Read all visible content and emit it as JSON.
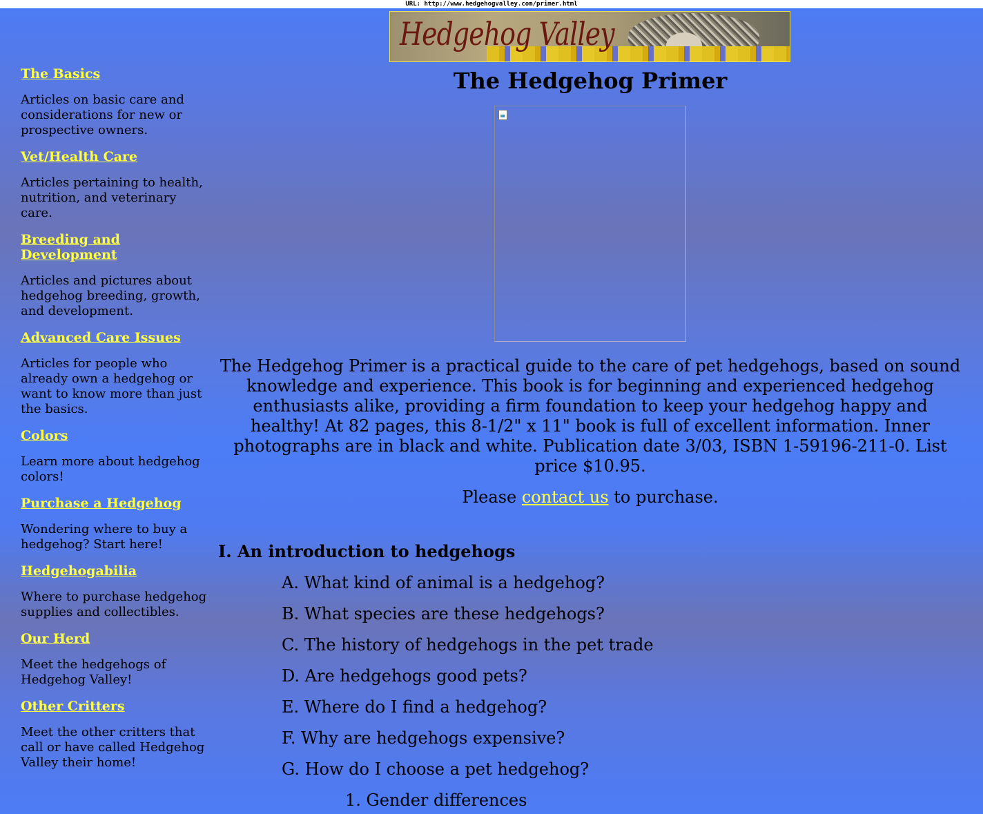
{
  "url_bar": "URL: http://www.hedgehogvalley.com/primer.html",
  "banner": {
    "logo_text": "Hedgehog Valley"
  },
  "sidebar": {
    "items": [
      {
        "label": "The Basics",
        "description": "Articles on basic care and considerations for new or prospective owners."
      },
      {
        "label": "Vet/Health Care",
        "description": "Articles pertaining to health, nutrition, and veterinary care."
      },
      {
        "label": "Breeding and Development",
        "description": "Articles and pictures about hedgehog breeding, growth, and development."
      },
      {
        "label": "Advanced Care Issues",
        "description": "Articles for people who already own a hedgehog or want to know more than just the basics."
      },
      {
        "label": "Colors",
        "description": "Learn more about hedgehog colors!"
      },
      {
        "label": "Purchase a Hedgehog",
        "description": "Wondering where to buy a hedgehog? Start here!"
      },
      {
        "label": "Hedgehogabilia",
        "description": "Where to purchase hedgehog supplies and collectibles."
      },
      {
        "label": "Our Herd",
        "description": "Meet the hedgehogs of Hedgehog Valley!"
      },
      {
        "label": "Other Critters",
        "description": "Meet the other critters that call or have called Hedgehog Valley their home!"
      }
    ]
  },
  "main": {
    "title": "The Hedgehog Primer",
    "description": "The Hedgehog Primer is a practical guide to the care of pet hedgehogs, based on sound knowledge and experience. This book is for beginning and experienced hedgehog enthusiasts alike, providing a firm foundation to keep your hedgehog happy and healthy! At 82 pages, this 8-1/2\" x 11\" book is full of excellent information. Inner photographs are in black and white. Publication date 3/03, ISBN 1-59196-211-0. List price $10.95.",
    "purchase": {
      "before": "Please ",
      "link": "contact us",
      "after": " to purchase."
    },
    "section_heading": "I. An introduction to hedgehogs",
    "toc": [
      "A. What kind of animal is a hedgehog?",
      "B. What species are these hedgehogs?",
      "C. The history of hedgehogs in the pet trade",
      "D. Are hedgehogs good pets?",
      "E. Where do I find a hedgehog?",
      "F. Why are hedgehogs expensive?",
      "G. How do I choose a pet hedgehog?"
    ],
    "toc_sub": [
      "1. Gender differences"
    ]
  },
  "colors": {
    "link": "#ffff40",
    "background": "#4c7cf6"
  }
}
